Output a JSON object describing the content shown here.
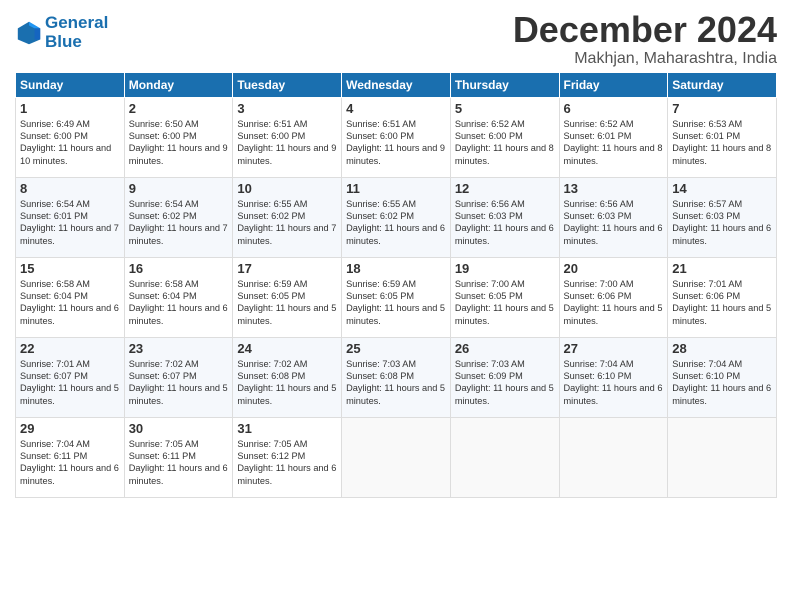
{
  "logo": {
    "line1": "General",
    "line2": "Blue"
  },
  "title": "December 2024",
  "location": "Makhjan, Maharashtra, India",
  "headers": [
    "Sunday",
    "Monday",
    "Tuesday",
    "Wednesday",
    "Thursday",
    "Friday",
    "Saturday"
  ],
  "weeks": [
    [
      {
        "day": "1",
        "sunrise": "6:49 AM",
        "sunset": "6:00 PM",
        "daylight": "11 hours and 10 minutes."
      },
      {
        "day": "2",
        "sunrise": "6:50 AM",
        "sunset": "6:00 PM",
        "daylight": "11 hours and 9 minutes."
      },
      {
        "day": "3",
        "sunrise": "6:51 AM",
        "sunset": "6:00 PM",
        "daylight": "11 hours and 9 minutes."
      },
      {
        "day": "4",
        "sunrise": "6:51 AM",
        "sunset": "6:00 PM",
        "daylight": "11 hours and 9 minutes."
      },
      {
        "day": "5",
        "sunrise": "6:52 AM",
        "sunset": "6:00 PM",
        "daylight": "11 hours and 8 minutes."
      },
      {
        "day": "6",
        "sunrise": "6:52 AM",
        "sunset": "6:01 PM",
        "daylight": "11 hours and 8 minutes."
      },
      {
        "day": "7",
        "sunrise": "6:53 AM",
        "sunset": "6:01 PM",
        "daylight": "11 hours and 8 minutes."
      }
    ],
    [
      {
        "day": "8",
        "sunrise": "6:54 AM",
        "sunset": "6:01 PM",
        "daylight": "11 hours and 7 minutes."
      },
      {
        "day": "9",
        "sunrise": "6:54 AM",
        "sunset": "6:02 PM",
        "daylight": "11 hours and 7 minutes."
      },
      {
        "day": "10",
        "sunrise": "6:55 AM",
        "sunset": "6:02 PM",
        "daylight": "11 hours and 7 minutes."
      },
      {
        "day": "11",
        "sunrise": "6:55 AM",
        "sunset": "6:02 PM",
        "daylight": "11 hours and 6 minutes."
      },
      {
        "day": "12",
        "sunrise": "6:56 AM",
        "sunset": "6:03 PM",
        "daylight": "11 hours and 6 minutes."
      },
      {
        "day": "13",
        "sunrise": "6:56 AM",
        "sunset": "6:03 PM",
        "daylight": "11 hours and 6 minutes."
      },
      {
        "day": "14",
        "sunrise": "6:57 AM",
        "sunset": "6:03 PM",
        "daylight": "11 hours and 6 minutes."
      }
    ],
    [
      {
        "day": "15",
        "sunrise": "6:58 AM",
        "sunset": "6:04 PM",
        "daylight": "11 hours and 6 minutes."
      },
      {
        "day": "16",
        "sunrise": "6:58 AM",
        "sunset": "6:04 PM",
        "daylight": "11 hours and 6 minutes."
      },
      {
        "day": "17",
        "sunrise": "6:59 AM",
        "sunset": "6:05 PM",
        "daylight": "11 hours and 5 minutes."
      },
      {
        "day": "18",
        "sunrise": "6:59 AM",
        "sunset": "6:05 PM",
        "daylight": "11 hours and 5 minutes."
      },
      {
        "day": "19",
        "sunrise": "7:00 AM",
        "sunset": "6:05 PM",
        "daylight": "11 hours and 5 minutes."
      },
      {
        "day": "20",
        "sunrise": "7:00 AM",
        "sunset": "6:06 PM",
        "daylight": "11 hours and 5 minutes."
      },
      {
        "day": "21",
        "sunrise": "7:01 AM",
        "sunset": "6:06 PM",
        "daylight": "11 hours and 5 minutes."
      }
    ],
    [
      {
        "day": "22",
        "sunrise": "7:01 AM",
        "sunset": "6:07 PM",
        "daylight": "11 hours and 5 minutes."
      },
      {
        "day": "23",
        "sunrise": "7:02 AM",
        "sunset": "6:07 PM",
        "daylight": "11 hours and 5 minutes."
      },
      {
        "day": "24",
        "sunrise": "7:02 AM",
        "sunset": "6:08 PM",
        "daylight": "11 hours and 5 minutes."
      },
      {
        "day": "25",
        "sunrise": "7:03 AM",
        "sunset": "6:08 PM",
        "daylight": "11 hours and 5 minutes."
      },
      {
        "day": "26",
        "sunrise": "7:03 AM",
        "sunset": "6:09 PM",
        "daylight": "11 hours and 5 minutes."
      },
      {
        "day": "27",
        "sunrise": "7:04 AM",
        "sunset": "6:10 PM",
        "daylight": "11 hours and 6 minutes."
      },
      {
        "day": "28",
        "sunrise": "7:04 AM",
        "sunset": "6:10 PM",
        "daylight": "11 hours and 6 minutes."
      }
    ],
    [
      {
        "day": "29",
        "sunrise": "7:04 AM",
        "sunset": "6:11 PM",
        "daylight": "11 hours and 6 minutes."
      },
      {
        "day": "30",
        "sunrise": "7:05 AM",
        "sunset": "6:11 PM",
        "daylight": "11 hours and 6 minutes."
      },
      {
        "day": "31",
        "sunrise": "7:05 AM",
        "sunset": "6:12 PM",
        "daylight": "11 hours and 6 minutes."
      },
      null,
      null,
      null,
      null
    ]
  ],
  "labels": {
    "sunrise": "Sunrise:",
    "sunset": "Sunset:",
    "daylight": "Daylight:"
  }
}
